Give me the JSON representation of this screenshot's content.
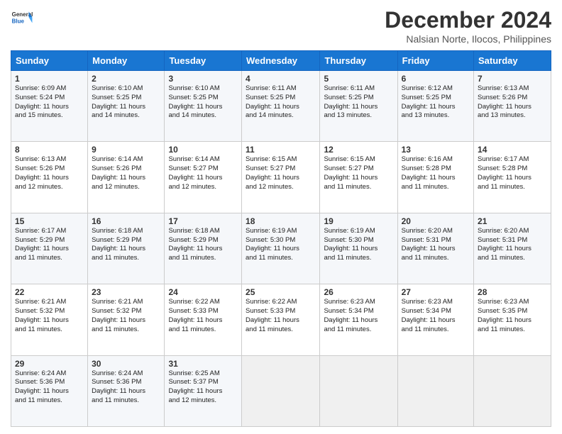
{
  "logo": {
    "general": "General",
    "blue": "Blue"
  },
  "header": {
    "month": "December 2024",
    "location": "Nalsian Norte, Ilocos, Philippines"
  },
  "weekdays": [
    "Sunday",
    "Monday",
    "Tuesday",
    "Wednesday",
    "Thursday",
    "Friday",
    "Saturday"
  ],
  "weeks": [
    [
      {
        "day": "1",
        "sunrise": "6:09 AM",
        "sunset": "5:24 PM",
        "daylight": "11 hours and 15 minutes."
      },
      {
        "day": "2",
        "sunrise": "6:10 AM",
        "sunset": "5:25 PM",
        "daylight": "11 hours and 14 minutes."
      },
      {
        "day": "3",
        "sunrise": "6:10 AM",
        "sunset": "5:25 PM",
        "daylight": "11 hours and 14 minutes."
      },
      {
        "day": "4",
        "sunrise": "6:11 AM",
        "sunset": "5:25 PM",
        "daylight": "11 hours and 14 minutes."
      },
      {
        "day": "5",
        "sunrise": "6:11 AM",
        "sunset": "5:25 PM",
        "daylight": "11 hours and 13 minutes."
      },
      {
        "day": "6",
        "sunrise": "6:12 AM",
        "sunset": "5:25 PM",
        "daylight": "11 hours and 13 minutes."
      },
      {
        "day": "7",
        "sunrise": "6:13 AM",
        "sunset": "5:26 PM",
        "daylight": "11 hours and 13 minutes."
      }
    ],
    [
      {
        "day": "8",
        "sunrise": "6:13 AM",
        "sunset": "5:26 PM",
        "daylight": "11 hours and 12 minutes."
      },
      {
        "day": "9",
        "sunrise": "6:14 AM",
        "sunset": "5:26 PM",
        "daylight": "11 hours and 12 minutes."
      },
      {
        "day": "10",
        "sunrise": "6:14 AM",
        "sunset": "5:27 PM",
        "daylight": "11 hours and 12 minutes."
      },
      {
        "day": "11",
        "sunrise": "6:15 AM",
        "sunset": "5:27 PM",
        "daylight": "11 hours and 12 minutes."
      },
      {
        "day": "12",
        "sunrise": "6:15 AM",
        "sunset": "5:27 PM",
        "daylight": "11 hours and 11 minutes."
      },
      {
        "day": "13",
        "sunrise": "6:16 AM",
        "sunset": "5:28 PM",
        "daylight": "11 hours and 11 minutes."
      },
      {
        "day": "14",
        "sunrise": "6:17 AM",
        "sunset": "5:28 PM",
        "daylight": "11 hours and 11 minutes."
      }
    ],
    [
      {
        "day": "15",
        "sunrise": "6:17 AM",
        "sunset": "5:29 PM",
        "daylight": "11 hours and 11 minutes."
      },
      {
        "day": "16",
        "sunrise": "6:18 AM",
        "sunset": "5:29 PM",
        "daylight": "11 hours and 11 minutes."
      },
      {
        "day": "17",
        "sunrise": "6:18 AM",
        "sunset": "5:29 PM",
        "daylight": "11 hours and 11 minutes."
      },
      {
        "day": "18",
        "sunrise": "6:19 AM",
        "sunset": "5:30 PM",
        "daylight": "11 hours and 11 minutes."
      },
      {
        "day": "19",
        "sunrise": "6:19 AM",
        "sunset": "5:30 PM",
        "daylight": "11 hours and 11 minutes."
      },
      {
        "day": "20",
        "sunrise": "6:20 AM",
        "sunset": "5:31 PM",
        "daylight": "11 hours and 11 minutes."
      },
      {
        "day": "21",
        "sunrise": "6:20 AM",
        "sunset": "5:31 PM",
        "daylight": "11 hours and 11 minutes."
      }
    ],
    [
      {
        "day": "22",
        "sunrise": "6:21 AM",
        "sunset": "5:32 PM",
        "daylight": "11 hours and 11 minutes."
      },
      {
        "day": "23",
        "sunrise": "6:21 AM",
        "sunset": "5:32 PM",
        "daylight": "11 hours and 11 minutes."
      },
      {
        "day": "24",
        "sunrise": "6:22 AM",
        "sunset": "5:33 PM",
        "daylight": "11 hours and 11 minutes."
      },
      {
        "day": "25",
        "sunrise": "6:22 AM",
        "sunset": "5:33 PM",
        "daylight": "11 hours and 11 minutes."
      },
      {
        "day": "26",
        "sunrise": "6:23 AM",
        "sunset": "5:34 PM",
        "daylight": "11 hours and 11 minutes."
      },
      {
        "day": "27",
        "sunrise": "6:23 AM",
        "sunset": "5:34 PM",
        "daylight": "11 hours and 11 minutes."
      },
      {
        "day": "28",
        "sunrise": "6:23 AM",
        "sunset": "5:35 PM",
        "daylight": "11 hours and 11 minutes."
      }
    ],
    [
      {
        "day": "29",
        "sunrise": "6:24 AM",
        "sunset": "5:36 PM",
        "daylight": "11 hours and 11 minutes."
      },
      {
        "day": "30",
        "sunrise": "6:24 AM",
        "sunset": "5:36 PM",
        "daylight": "11 hours and 11 minutes."
      },
      {
        "day": "31",
        "sunrise": "6:25 AM",
        "sunset": "5:37 PM",
        "daylight": "11 hours and 12 minutes."
      },
      null,
      null,
      null,
      null
    ]
  ],
  "labels": {
    "sunrise": "Sunrise:",
    "sunset": "Sunset:",
    "daylight": "Daylight:"
  }
}
